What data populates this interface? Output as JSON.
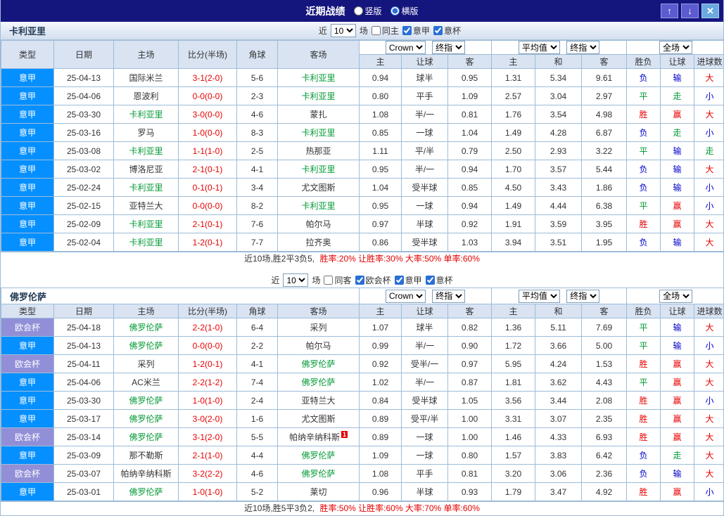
{
  "titlebar": {
    "title": "近期战绩",
    "layout_options": [
      {
        "label": "竖版",
        "selected": false
      },
      {
        "label": "横版",
        "selected": true
      }
    ],
    "buttons": {
      "up": "↑",
      "down": "↓",
      "close": "✕"
    }
  },
  "columns": {
    "type": "类型",
    "date": "日期",
    "home": "主场",
    "score": "比分(半场)",
    "corners": "角球",
    "away": "客场",
    "crown_home": "主",
    "crown_handicap": "让球",
    "crown_away": "客",
    "avg_home": "主",
    "avg_draw": "和",
    "avg_away": "客",
    "result": "胜负",
    "handicap_result": "让球",
    "goals": "进球数"
  },
  "type_colors": {
    "意甲": "#0690ff",
    "欧会杯": "#918fd7"
  },
  "outcome_colors": {
    "胜": "#e60000",
    "赢": "#e60000",
    "大": "#e60000",
    "平": "#009933",
    "走": "#009933",
    "负": "#0000cc",
    "输": "#0000cc",
    "小": "#0000cc"
  },
  "sections": [
    {
      "team": "卡利亚里",
      "filters": {
        "prefix": "近",
        "count": "10",
        "suffix": "场",
        "options": [
          {
            "label": "同主",
            "checked": false
          },
          {
            "label": "意甲",
            "checked": true
          },
          {
            "label": "意杯",
            "checked": true
          }
        ]
      },
      "dropdowns": {
        "source": "Crown",
        "final_a": "终指",
        "average": "平均值",
        "final_b": "终指",
        "scope": "全场"
      },
      "rows": [
        {
          "type": "意甲",
          "date": "25-04-13",
          "home": "国际米兰",
          "home_focus": false,
          "score": "3-1(2-0)",
          "corners": "5-6",
          "away": "卡利亚里",
          "away_focus": true,
          "crown": [
            "0.94",
            "球半",
            "0.95"
          ],
          "avg": [
            "1.31",
            "5.34",
            "9.61"
          ],
          "outcome": [
            "负",
            "输",
            "大"
          ]
        },
        {
          "type": "意甲",
          "date": "25-04-06",
          "home": "恩波利",
          "home_focus": false,
          "score": "0-0(0-0)",
          "corners": "2-3",
          "away": "卡利亚里",
          "away_focus": true,
          "crown": [
            "0.80",
            "平手",
            "1.09"
          ],
          "avg": [
            "2.57",
            "3.04",
            "2.97"
          ],
          "outcome": [
            "平",
            "走",
            "小"
          ]
        },
        {
          "type": "意甲",
          "date": "25-03-30",
          "home": "卡利亚里",
          "home_focus": true,
          "score": "3-0(0-0)",
          "corners": "4-6",
          "away": "蒙扎",
          "away_focus": false,
          "crown": [
            "1.08",
            "半/一",
            "0.81"
          ],
          "avg": [
            "1.76",
            "3.54",
            "4.98"
          ],
          "outcome": [
            "胜",
            "赢",
            "大"
          ]
        },
        {
          "type": "意甲",
          "date": "25-03-16",
          "home": "罗马",
          "home_focus": false,
          "score": "1-0(0-0)",
          "corners": "8-3",
          "away": "卡利亚里",
          "away_focus": true,
          "crown": [
            "0.85",
            "一球",
            "1.04"
          ],
          "avg": [
            "1.49",
            "4.28",
            "6.87"
          ],
          "outcome": [
            "负",
            "走",
            "小"
          ]
        },
        {
          "type": "意甲",
          "date": "25-03-08",
          "home": "卡利亚里",
          "home_focus": true,
          "score": "1-1(1-0)",
          "corners": "2-5",
          "away": "热那亚",
          "away_focus": false,
          "crown": [
            "1.11",
            "平/半",
            "0.79"
          ],
          "avg": [
            "2.50",
            "2.93",
            "3.22"
          ],
          "outcome": [
            "平",
            "输",
            "走"
          ]
        },
        {
          "type": "意甲",
          "date": "25-03-02",
          "home": "博洛尼亚",
          "home_focus": false,
          "score": "2-1(0-1)",
          "corners": "4-1",
          "away": "卡利亚里",
          "away_focus": true,
          "crown": [
            "0.95",
            "半/一",
            "0.94"
          ],
          "avg": [
            "1.70",
            "3.57",
            "5.44"
          ],
          "outcome": [
            "负",
            "输",
            "大"
          ]
        },
        {
          "type": "意甲",
          "date": "25-02-24",
          "home": "卡利亚里",
          "home_focus": true,
          "score": "0-1(0-1)",
          "corners": "3-4",
          "away": "尤文图斯",
          "away_focus": false,
          "crown": [
            "1.04",
            "受半球",
            "0.85"
          ],
          "avg": [
            "4.50",
            "3.43",
            "1.86"
          ],
          "outcome": [
            "负",
            "输",
            "小"
          ]
        },
        {
          "type": "意甲",
          "date": "25-02-15",
          "home": "亚特兰大",
          "home_focus": false,
          "score": "0-0(0-0)",
          "corners": "8-2",
          "away": "卡利亚里",
          "away_focus": true,
          "crown": [
            "0.95",
            "一球",
            "0.94"
          ],
          "avg": [
            "1.49",
            "4.44",
            "6.38"
          ],
          "outcome": [
            "平",
            "赢",
            "小"
          ]
        },
        {
          "type": "意甲",
          "date": "25-02-09",
          "home": "卡利亚里",
          "home_focus": true,
          "score": "2-1(0-1)",
          "corners": "7-6",
          "away": "帕尔马",
          "away_focus": false,
          "crown": [
            "0.97",
            "半球",
            "0.92"
          ],
          "avg": [
            "1.91",
            "3.59",
            "3.95"
          ],
          "outcome": [
            "胜",
            "赢",
            "大"
          ]
        },
        {
          "type": "意甲",
          "date": "25-02-04",
          "home": "卡利亚里",
          "home_focus": true,
          "score": "1-2(0-1)",
          "corners": "7-7",
          "away": "拉齐奥",
          "away_focus": false,
          "crown": [
            "0.86",
            "受半球",
            "1.03"
          ],
          "avg": [
            "3.94",
            "3.51",
            "1.95"
          ],
          "outcome": [
            "负",
            "输",
            "大"
          ]
        }
      ],
      "summary": {
        "record": "近10场,胜2平3负5,",
        "rates": "胜率:20% 让胜率:30% 大率:50% 单率:60%"
      }
    },
    {
      "team": "佛罗伦萨",
      "filters": {
        "prefix": "近",
        "count": "10",
        "suffix": "场",
        "options": [
          {
            "label": "同客",
            "checked": false
          },
          {
            "label": "欧会杯",
            "checked": true
          },
          {
            "label": "意甲",
            "checked": true
          },
          {
            "label": "意杯",
            "checked": true
          }
        ]
      },
      "dropdowns": {
        "source": "Crown",
        "final_a": "终指",
        "average": "平均值",
        "final_b": "终指",
        "scope": "全场"
      },
      "rows": [
        {
          "type": "欧会杯",
          "date": "25-04-18",
          "home": "佛罗伦萨",
          "home_focus": true,
          "score": "2-2(1-0)",
          "corners": "6-4",
          "away": "采列",
          "away_focus": false,
          "crown": [
            "1.07",
            "球半",
            "0.82"
          ],
          "avg": [
            "1.36",
            "5.11",
            "7.69"
          ],
          "outcome": [
            "平",
            "输",
            "大"
          ]
        },
        {
          "type": "意甲",
          "date": "25-04-13",
          "home": "佛罗伦萨",
          "home_focus": true,
          "score": "0-0(0-0)",
          "corners": "2-2",
          "away": "帕尔马",
          "away_focus": false,
          "crown": [
            "0.99",
            "半/一",
            "0.90"
          ],
          "avg": [
            "1.72",
            "3.66",
            "5.00"
          ],
          "outcome": [
            "平",
            "输",
            "小"
          ]
        },
        {
          "type": "欧会杯",
          "date": "25-04-11",
          "home": "采列",
          "home_focus": false,
          "score": "1-2(0-1)",
          "corners": "4-1",
          "away": "佛罗伦萨",
          "away_focus": true,
          "crown": [
            "0.92",
            "受半/一",
            "0.97"
          ],
          "avg": [
            "5.95",
            "4.24",
            "1.53"
          ],
          "outcome": [
            "胜",
            "赢",
            "大"
          ]
        },
        {
          "type": "意甲",
          "date": "25-04-06",
          "home": "AC米兰",
          "home_focus": false,
          "score": "2-2(1-2)",
          "corners": "7-4",
          "away": "佛罗伦萨",
          "away_focus": true,
          "crown": [
            "1.02",
            "半/一",
            "0.87"
          ],
          "avg": [
            "1.81",
            "3.62",
            "4.43"
          ],
          "outcome": [
            "平",
            "赢",
            "大"
          ]
        },
        {
          "type": "意甲",
          "date": "25-03-30",
          "home": "佛罗伦萨",
          "home_focus": true,
          "score": "1-0(1-0)",
          "corners": "2-4",
          "away": "亚特兰大",
          "away_focus": false,
          "crown": [
            "0.84",
            "受半球",
            "1.05"
          ],
          "avg": [
            "3.56",
            "3.44",
            "2.08"
          ],
          "outcome": [
            "胜",
            "赢",
            "小"
          ]
        },
        {
          "type": "意甲",
          "date": "25-03-17",
          "home": "佛罗伦萨",
          "home_focus": true,
          "score": "3-0(2-0)",
          "corners": "1-6",
          "away": "尤文图斯",
          "away_focus": false,
          "crown": [
            "0.89",
            "受平/半",
            "1.00"
          ],
          "avg": [
            "3.31",
            "3.07",
            "2.35"
          ],
          "outcome": [
            "胜",
            "赢",
            "大"
          ]
        },
        {
          "type": "欧会杯",
          "date": "25-03-14",
          "home": "佛罗伦萨",
          "home_focus": true,
          "score": "3-1(2-0)",
          "corners": "5-5",
          "away": "帕纳辛纳科斯",
          "away_focus": false,
          "red_cards": "1",
          "crown": [
            "0.89",
            "一球",
            "1.00"
          ],
          "avg": [
            "1.46",
            "4.33",
            "6.93"
          ],
          "outcome": [
            "胜",
            "赢",
            "大"
          ]
        },
        {
          "type": "意甲",
          "date": "25-03-09",
          "home": "那不勒斯",
          "home_focus": false,
          "score": "2-1(1-0)",
          "corners": "4-4",
          "away": "佛罗伦萨",
          "away_focus": true,
          "crown": [
            "1.09",
            "一球",
            "0.80"
          ],
          "avg": [
            "1.57",
            "3.83",
            "6.42"
          ],
          "outcome": [
            "负",
            "走",
            "大"
          ]
        },
        {
          "type": "欧会杯",
          "date": "25-03-07",
          "home": "帕纳辛纳科斯",
          "home_focus": false,
          "score": "3-2(2-2)",
          "corners": "4-6",
          "away": "佛罗伦萨",
          "away_focus": true,
          "crown": [
            "1.08",
            "平手",
            "0.81"
          ],
          "avg": [
            "3.20",
            "3.06",
            "2.36"
          ],
          "outcome": [
            "负",
            "输",
            "大"
          ]
        },
        {
          "type": "意甲",
          "date": "25-03-01",
          "home": "佛罗伦萨",
          "home_focus": true,
          "score": "1-0(1-0)",
          "corners": "5-2",
          "away": "莱切",
          "away_focus": false,
          "crown": [
            "0.96",
            "半球",
            "0.93"
          ],
          "avg": [
            "1.79",
            "3.47",
            "4.92"
          ],
          "outcome": [
            "胜",
            "赢",
            "小"
          ]
        }
      ],
      "summary": {
        "record": "近10场,胜5平3负2,",
        "rates": "胜率:50% 让胜率:60% 大率:70% 单率:60%"
      }
    }
  ]
}
